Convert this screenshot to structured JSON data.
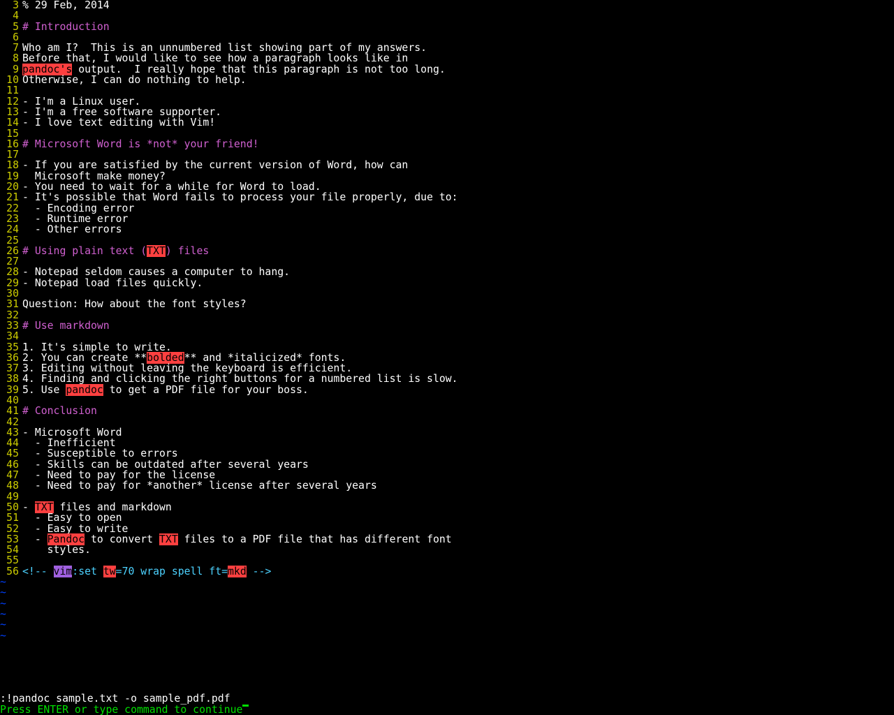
{
  "lines": [
    {
      "n": "3",
      "type": "text",
      "segs": [
        {
          "t": "% 29 Feb, 2014"
        }
      ]
    },
    {
      "n": "4",
      "type": "text",
      "segs": []
    },
    {
      "n": "5",
      "type": "head",
      "segs": [
        {
          "t": "# Introduction"
        }
      ]
    },
    {
      "n": "6",
      "type": "text",
      "segs": []
    },
    {
      "n": "7",
      "type": "text",
      "segs": [
        {
          "t": "Who am I?  This is an unnumbered list showing part of my answers."
        }
      ]
    },
    {
      "n": "8",
      "type": "text",
      "segs": [
        {
          "t": "Before that, I would like to see how a paragraph looks like in"
        }
      ]
    },
    {
      "n": "9",
      "type": "text",
      "segs": [
        {
          "cls": "spell-bad",
          "t": "pandoc's"
        },
        {
          "t": " output.  I really hope that this paragraph is not too long."
        }
      ]
    },
    {
      "n": "10",
      "type": "text",
      "segs": [
        {
          "t": "Otherwise, I can do nothing to help."
        }
      ]
    },
    {
      "n": "11",
      "type": "text",
      "segs": []
    },
    {
      "n": "12",
      "type": "text",
      "segs": [
        {
          "t": "- I'm a Linux user."
        }
      ]
    },
    {
      "n": "13",
      "type": "text",
      "segs": [
        {
          "t": "- I'm a free software supporter."
        }
      ]
    },
    {
      "n": "14",
      "type": "text",
      "segs": [
        {
          "t": "- I love text editing with Vim!"
        }
      ]
    },
    {
      "n": "15",
      "type": "text",
      "segs": []
    },
    {
      "n": "16",
      "type": "head",
      "segs": [
        {
          "t": "# Microsoft Word is *not* your friend!"
        }
      ]
    },
    {
      "n": "17",
      "type": "text",
      "segs": []
    },
    {
      "n": "18",
      "type": "text",
      "segs": [
        {
          "t": "- If you are satisfied by the current version of Word, how can"
        }
      ]
    },
    {
      "n": "19",
      "type": "text",
      "segs": [
        {
          "t": "  Microsoft make money?"
        }
      ]
    },
    {
      "n": "20",
      "type": "text",
      "segs": [
        {
          "t": "- You need to wait for a while for Word to load."
        }
      ]
    },
    {
      "n": "21",
      "type": "text",
      "segs": [
        {
          "t": "- It's possible that Word fails to process your file properly, due to:"
        }
      ]
    },
    {
      "n": "22",
      "type": "text",
      "segs": [
        {
          "t": "  - Encoding error"
        }
      ]
    },
    {
      "n": "23",
      "type": "text",
      "segs": [
        {
          "t": "  - Runtime error"
        }
      ]
    },
    {
      "n": "24",
      "type": "text",
      "segs": [
        {
          "t": "  - Other errors"
        }
      ]
    },
    {
      "n": "25",
      "type": "text",
      "segs": []
    },
    {
      "n": "26",
      "type": "head",
      "segs": [
        {
          "t": "# Using plain text ("
        },
        {
          "cls": "spell-bad",
          "t": "TXT"
        },
        {
          "t": ") files"
        }
      ]
    },
    {
      "n": "27",
      "type": "text",
      "segs": []
    },
    {
      "n": "28",
      "type": "text",
      "segs": [
        {
          "t": "- Notepad seldom causes a computer to hang."
        }
      ]
    },
    {
      "n": "29",
      "type": "text",
      "segs": [
        {
          "t": "- Notepad load files quickly."
        }
      ]
    },
    {
      "n": "30",
      "type": "text",
      "segs": []
    },
    {
      "n": "31",
      "type": "text",
      "segs": [
        {
          "t": "Question: How about the font styles?"
        }
      ]
    },
    {
      "n": "32",
      "type": "text",
      "segs": []
    },
    {
      "n": "33",
      "type": "head",
      "segs": [
        {
          "t": "# Use markdown"
        }
      ]
    },
    {
      "n": "34",
      "type": "text",
      "segs": []
    },
    {
      "n": "35",
      "type": "text",
      "segs": [
        {
          "t": "1. It's simple to write."
        }
      ]
    },
    {
      "n": "36",
      "type": "text",
      "segs": [
        {
          "t": "2. You can create **"
        },
        {
          "cls": "spell-bad",
          "t": "bolded"
        },
        {
          "t": "** and *italicized* fonts."
        }
      ]
    },
    {
      "n": "37",
      "type": "text",
      "segs": [
        {
          "t": "3. Editing without leaving the keyboard is efficient."
        }
      ]
    },
    {
      "n": "38",
      "type": "text",
      "segs": [
        {
          "t": "4. Finding and clicking the right buttons for a numbered list is slow."
        }
      ]
    },
    {
      "n": "39",
      "type": "text",
      "segs": [
        {
          "t": "5. Use "
        },
        {
          "cls": "spell-bad",
          "t": "pandoc"
        },
        {
          "t": " to get a PDF file for your boss."
        }
      ]
    },
    {
      "n": "40",
      "type": "text",
      "segs": []
    },
    {
      "n": "41",
      "type": "head",
      "segs": [
        {
          "t": "# Conclusion"
        }
      ]
    },
    {
      "n": "42",
      "type": "text",
      "segs": []
    },
    {
      "n": "43",
      "type": "text",
      "segs": [
        {
          "t": "- Microsoft Word"
        }
      ]
    },
    {
      "n": "44",
      "type": "text",
      "segs": [
        {
          "t": "  - Inefficient"
        }
      ]
    },
    {
      "n": "45",
      "type": "text",
      "segs": [
        {
          "t": "  - Susceptible to errors"
        }
      ]
    },
    {
      "n": "46",
      "type": "text",
      "segs": [
        {
          "t": "  - Skills can be outdated after several years"
        }
      ]
    },
    {
      "n": "47",
      "type": "text",
      "segs": [
        {
          "t": "  - Need to pay for the license"
        }
      ]
    },
    {
      "n": "48",
      "type": "text",
      "segs": [
        {
          "t": "  - Need to pay for *another* license after several years"
        }
      ]
    },
    {
      "n": "49",
      "type": "text",
      "segs": []
    },
    {
      "n": "50",
      "type": "text",
      "segs": [
        {
          "t": "- "
        },
        {
          "cls": "spell-bad",
          "t": "TXT"
        },
        {
          "t": " files and markdown"
        }
      ]
    },
    {
      "n": "51",
      "type": "text",
      "segs": [
        {
          "t": "  - Easy to open"
        }
      ]
    },
    {
      "n": "52",
      "type": "text",
      "segs": [
        {
          "t": "  - Easy to write"
        }
      ]
    },
    {
      "n": "53",
      "type": "text",
      "segs": [
        {
          "t": "  - "
        },
        {
          "cls": "spell-bad",
          "t": "Pandoc"
        },
        {
          "t": " to convert "
        },
        {
          "cls": "spell-bad",
          "t": "TXT"
        },
        {
          "t": " files to a PDF file that has different font"
        }
      ]
    },
    {
      "n": "54",
      "type": "text",
      "segs": [
        {
          "t": "    styles."
        }
      ]
    },
    {
      "n": "55",
      "type": "text",
      "segs": []
    },
    {
      "n": "56",
      "type": "comment",
      "segs": [
        {
          "t": "<!-- "
        },
        {
          "cls": "spell-purple",
          "t": "vim"
        },
        {
          "t": ":set "
        },
        {
          "cls": "spell-bad",
          "t": "tw"
        },
        {
          "t": "=70 wrap spell ft="
        },
        {
          "cls": "spell-bad",
          "t": "mkd"
        },
        {
          "t": " -->"
        }
      ]
    }
  ],
  "tilde_count": 6,
  "tilde_char": "~",
  "empty_line_before_cmd": true,
  "command_line": ":!pandoc sample.txt -o sample_pdf.pdf",
  "prompt_line": "Press ENTER or type command to continue"
}
